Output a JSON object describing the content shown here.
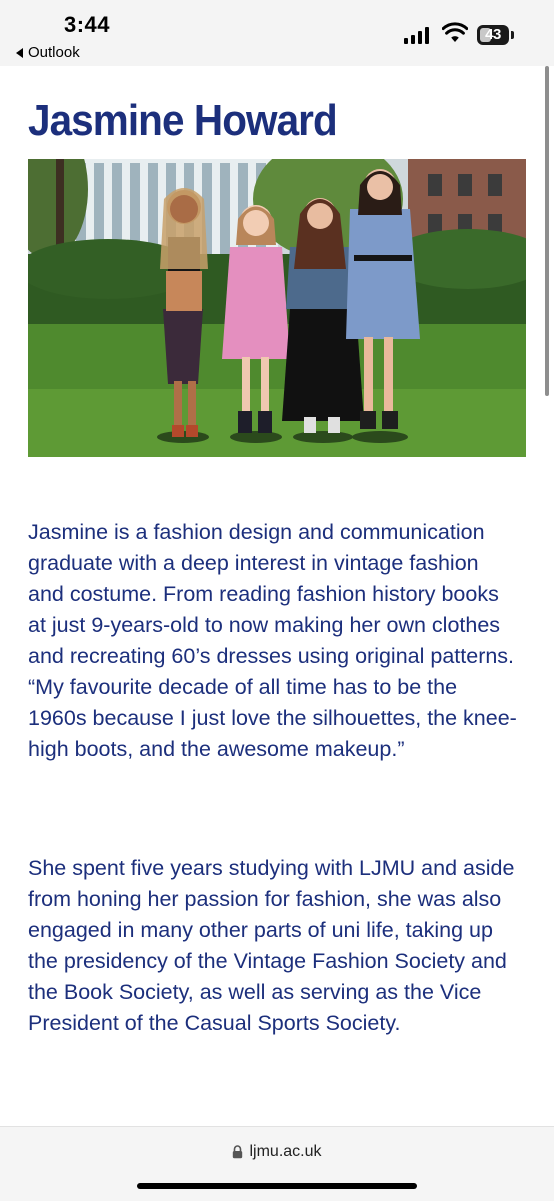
{
  "status_bar": {
    "time": "3:44",
    "back_app": "Outlook",
    "battery_level": "43"
  },
  "page": {
    "title": "Jasmine Howard",
    "photo_icon": "group-photo",
    "paragraphs": [
      "Jasmine is a fashion design and communication graduate with a deep interest in vintage fashion and costume. From reading fashion history books at just 9-years-old to now making her own clothes and recreating 60’s dresses using original patterns. “My favourite decade of all time has to be the 1960s because I just love the silhouettes, the knee-high boots, and the awesome makeup.”",
      "She spent five years studying with LJMU and aside from honing her passion for fashion, she was also engaged in many other parts of uni life, taking up the presidency of the Vintage Fashion Society and the Book Society, as well as serving as the Vice President of the Casual Sports Society."
    ]
  },
  "browser": {
    "url": "ljmu.ac.uk"
  },
  "colors": {
    "title": "#1c2f7c",
    "body_text": "#1c2f7c"
  }
}
